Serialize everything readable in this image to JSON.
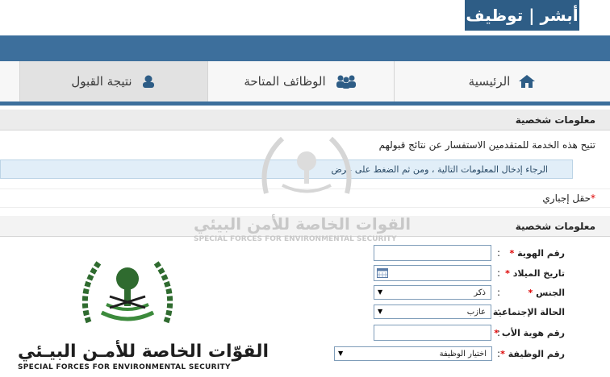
{
  "header": {
    "logo_text": "أبشر | توظيف"
  },
  "nav": {
    "tabs": [
      {
        "label": "الرئيسية",
        "icon": "home-icon"
      },
      {
        "label": "الوظائف المتاحة",
        "icon": "people-icon"
      },
      {
        "label": "نتيجة القبول",
        "icon": "user-icon"
      }
    ]
  },
  "page": {
    "section_title": "معلومات شخصية",
    "intro": "تتيح هذه الخدمة للمتقدمين الاستفسار عن نتائج قبولهم",
    "notice": "الرجاء إدخال المعلومات التالية ، ومن ثم الضغط على عرض",
    "required_note": "حقل إجباري",
    "form_title": "معلومات شخصية"
  },
  "form": {
    "id_label": "رقم الهوية",
    "dob_label": "تاريخ الميلاد",
    "gender_label": "الجنس",
    "gender_value": "ذكر",
    "marital_label": "الحالة الإجتماعية",
    "marital_value": "عازب",
    "father_id_label": "رقم هوية الأب",
    "job_label": "رقم الوظيفة",
    "job_value": "اختيار الوظيفة",
    "colon": ":"
  },
  "watermark": {
    "arabic": "القوات الخاصة للأمن البيئي",
    "english": "SPECIAL FORCES FOR ENVIRONMENTAL SECURITY"
  },
  "brand": {
    "arabic": "القوّات الخاصة للأمـن البيـئي",
    "english": "SPECIAL FORCES FOR ENVIRONMENTAL SECURITY"
  },
  "colors": {
    "primary": "#3d6f9c",
    "logo_bg": "#2e5d86",
    "required": "#dd0000"
  }
}
